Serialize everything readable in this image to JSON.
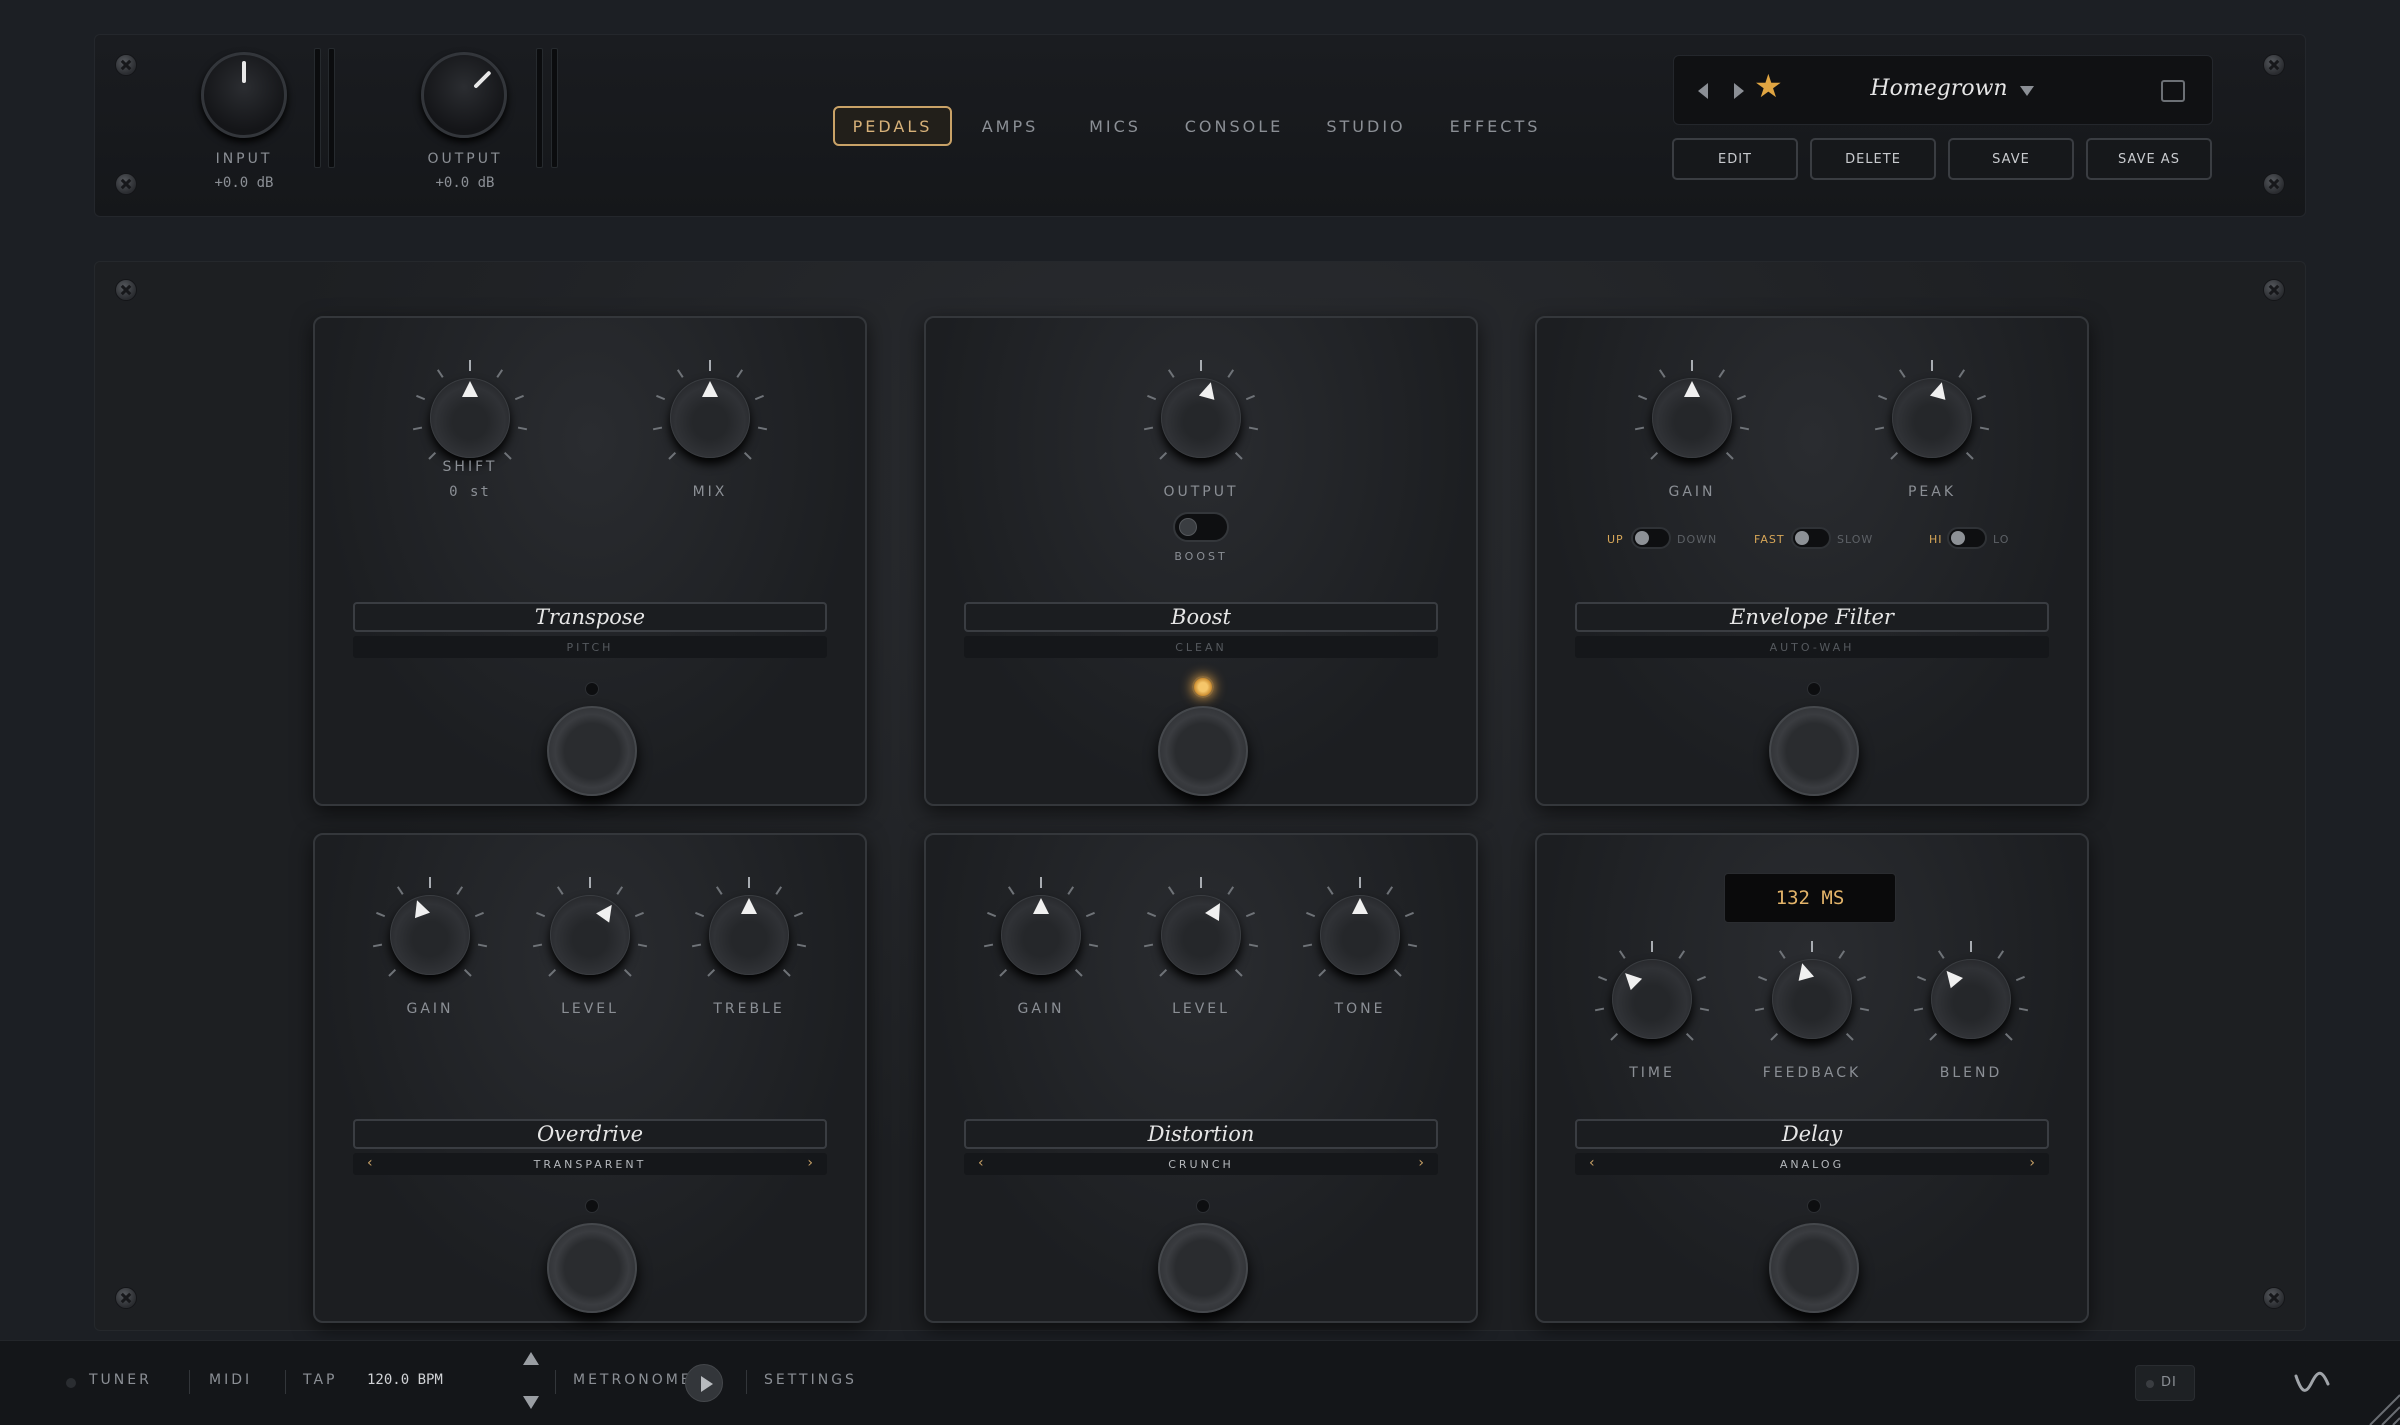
{
  "io": {
    "input": {
      "label": "INPUT",
      "value": "+0.0 dB"
    },
    "output": {
      "label": "OUTPUT",
      "value": "+0.0 dB"
    }
  },
  "nav": {
    "tabs": [
      {
        "label": "PEDALS",
        "active": true
      },
      {
        "label": "AMPS",
        "active": false
      },
      {
        "label": "MICS",
        "active": false
      },
      {
        "label": "CONSOLE",
        "active": false
      },
      {
        "label": "STUDIO",
        "active": false
      },
      {
        "label": "EFFECTS",
        "active": false
      }
    ]
  },
  "preset": {
    "name": "Homegrown",
    "prev_icon": "left-triangle",
    "next_icon": "right-triangle",
    "favorite_icon": "star",
    "favorite_color": "#e0a542",
    "buttons": {
      "edit": "EDIT",
      "delete": "DELETE",
      "save": "SAVE",
      "save_as": "SAVE AS"
    }
  },
  "pedals": {
    "transpose": {
      "name": "Transpose",
      "subtitle": "PITCH",
      "knobs": [
        {
          "label": "SHIFT",
          "value": "0 st"
        },
        {
          "label": "MIX"
        }
      ],
      "active": false
    },
    "boost": {
      "name": "Boost",
      "subtitle": "CLEAN",
      "knobs": [
        {
          "label": "OUTPUT"
        }
      ],
      "toggle_label": "BOOST",
      "active": true
    },
    "envelope": {
      "name": "Envelope Filter",
      "subtitle": "AUTO-WAH",
      "knobs": [
        {
          "label": "GAIN"
        },
        {
          "label": "PEAK"
        }
      ],
      "switches": [
        {
          "left": "UP",
          "right": "DOWN"
        },
        {
          "left": "FAST",
          "right": "SLOW"
        },
        {
          "left": "HI",
          "right": "LO"
        }
      ],
      "active": false
    },
    "overdrive": {
      "name": "Overdrive",
      "mode": "TRANSPARENT",
      "knobs": [
        {
          "label": "GAIN"
        },
        {
          "label": "LEVEL"
        },
        {
          "label": "TREBLE"
        }
      ],
      "active": false
    },
    "distortion": {
      "name": "Distortion",
      "mode": "CRUNCH",
      "knobs": [
        {
          "label": "GAIN"
        },
        {
          "label": "LEVEL"
        },
        {
          "label": "TONE"
        }
      ],
      "active": false
    },
    "delay": {
      "name": "Delay",
      "mode": "ANALOG",
      "display": "132 MS",
      "knobs": [
        {
          "label": "TIME"
        },
        {
          "label": "FEEDBACK"
        },
        {
          "label": "BLEND"
        }
      ],
      "active": false
    }
  },
  "statusbar": {
    "tuner": "TUNER",
    "midi": "MIDI",
    "tap": "TAP",
    "bpm": "120.0 BPM",
    "metronome": "METRONOME",
    "settings": "SETTINGS",
    "di": "DI"
  },
  "colors": {
    "accent": "#c9a267",
    "led_on": "#f5c66a",
    "display_text": "#e3b46a"
  }
}
